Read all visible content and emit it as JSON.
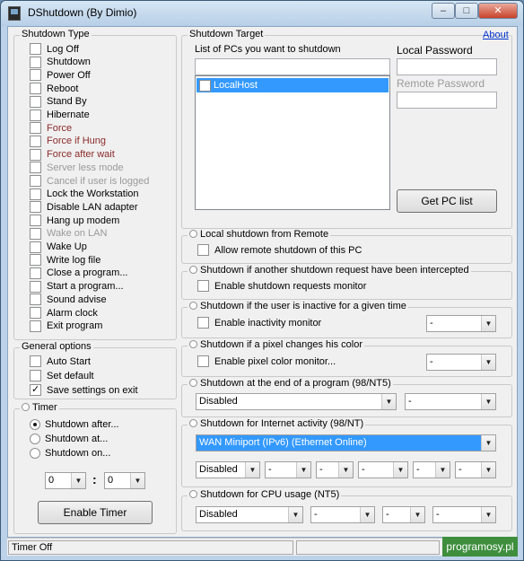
{
  "window": {
    "title": "DShutdown (By Dimio)",
    "minimize": "–",
    "maximize": "□",
    "close": "✕"
  },
  "shutdown_type": {
    "label": "Shutdown Type",
    "items": [
      {
        "label": "Log Off",
        "style": "normal"
      },
      {
        "label": "Shutdown",
        "style": "normal"
      },
      {
        "label": "Power Off",
        "style": "normal"
      },
      {
        "label": "Reboot",
        "style": "normal"
      },
      {
        "label": "Stand By",
        "style": "normal"
      },
      {
        "label": "Hibernate",
        "style": "normal"
      },
      {
        "label": "Force",
        "style": "red"
      },
      {
        "label": "Force if Hung",
        "style": "red"
      },
      {
        "label": "Force after wait",
        "style": "red"
      },
      {
        "label": "Server less mode",
        "style": "gray"
      },
      {
        "label": "Cancel if user is logged",
        "style": "gray"
      },
      {
        "label": "Lock the Workstation",
        "style": "normal"
      },
      {
        "label": "Disable LAN adapter",
        "style": "normal"
      },
      {
        "label": "Hang up modem",
        "style": "normal"
      },
      {
        "label": "Wake on LAN",
        "style": "gray"
      },
      {
        "label": "Wake Up",
        "style": "normal"
      },
      {
        "label": "Write log file",
        "style": "normal"
      },
      {
        "label": "Close a program...",
        "style": "normal"
      },
      {
        "label": "Start a program...",
        "style": "normal"
      },
      {
        "label": "Sound advise",
        "style": "normal"
      },
      {
        "label": "Alarm clock",
        "style": "normal"
      },
      {
        "label": "Exit program",
        "style": "normal"
      }
    ]
  },
  "general_options": {
    "label": "General options",
    "items": [
      {
        "label": "Auto Start",
        "checked": false
      },
      {
        "label": "Set default",
        "checked": false
      },
      {
        "label": "Save settings on exit",
        "checked": true
      }
    ]
  },
  "timer": {
    "label": "Timer",
    "options": [
      {
        "label": "Shutdown after...",
        "checked": true
      },
      {
        "label": "Shutdown at...",
        "checked": false
      },
      {
        "label": "Shutdown on...",
        "checked": false
      }
    ],
    "hours": "0",
    "separator": ":",
    "minutes": "0",
    "button": "Enable Timer"
  },
  "target": {
    "label": "Shutdown Target",
    "about": "About",
    "list_label": "List of PCs you want to shutdown",
    "pc_input": "",
    "pcs": [
      {
        "label": "LocalHost",
        "checked": true
      }
    ],
    "local_password_label": "Local Password",
    "local_password": "",
    "remote_password_label": "Remote Password",
    "remote_password": "",
    "get_list_button": "Get PC list"
  },
  "sections": {
    "local_remote": {
      "label": "Local shutdown from Remote",
      "check": "Allow remote shutdown of this PC"
    },
    "intercepted": {
      "label": "Shutdown if another shutdown request have been intercepted",
      "check": "Enable shutdown requests monitor"
    },
    "inactive": {
      "label": "Shutdown if the user is inactive for a given time",
      "check": "Enable inactivity monitor",
      "combo": "-"
    },
    "pixel": {
      "label": "Shutdown if a pixel changes his color",
      "check": "Enable pixel color monitor...",
      "combo": "-"
    },
    "program_end": {
      "label": "Shutdown at the end of a program (98/NT5)",
      "combo1": "Disabled",
      "combo2": "-"
    },
    "internet": {
      "label": "Shutdown for Internet activity (98/NT)",
      "adapter": "WAN Miniport (IPv6) (Ethernet Online)",
      "mode": "Disabled",
      "combos": [
        "-",
        "-",
        "-",
        "-",
        "-"
      ]
    },
    "cpu": {
      "label": "Shutdown for CPU usage (NT5)",
      "mode": "Disabled",
      "combos": [
        "-",
        "-",
        "-"
      ]
    }
  },
  "status": {
    "text": "Timer Off",
    "pane2": ""
  },
  "watermark": "programosy.pl"
}
